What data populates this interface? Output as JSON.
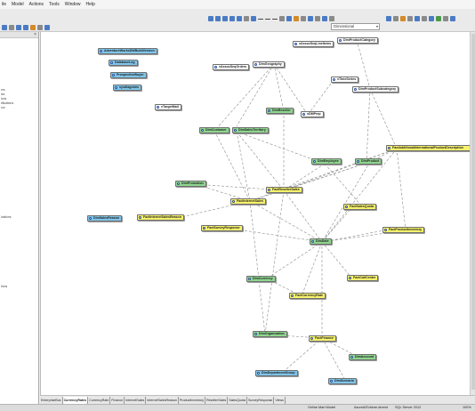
{
  "menubar": {
    "items": [
      "ile",
      "Model",
      "Actions",
      "Tools",
      "Window",
      "Help"
    ]
  },
  "toolbar": {
    "dimension_select": "Dimensional"
  },
  "left_panel": {
    "items": [
      "ers",
      "ies",
      "ions",
      "tifications",
      "rce",
      "ications",
      "tions"
    ]
  },
  "tables": [
    {
      "label": "AdventureWorksDWBuildVersion",
      "color": "blue"
    },
    {
      "label": "DatabaseLog",
      "color": "blue"
    },
    {
      "label": "ProspectiveBuyer",
      "color": "blue"
    },
    {
      "label": "sysdiagrams",
      "color": "blue"
    },
    {
      "label": "vAssocSeqLineItems",
      "color": "white"
    },
    {
      "label": "DimGeography",
      "color": "white"
    },
    {
      "label": "vAssocSeqOrders",
      "color": "white"
    },
    {
      "label": "DimProductCategory",
      "color": "white"
    },
    {
      "label": "vTimeSeries",
      "color": "white"
    },
    {
      "label": "DimProductSubcategory",
      "color": "white"
    },
    {
      "label": "vTargetMail",
      "color": "white"
    },
    {
      "label": "DimReseller",
      "color": "green"
    },
    {
      "label": "vDMPrep",
      "color": "white"
    },
    {
      "label": "DimCustomer",
      "color": "green"
    },
    {
      "label": "DimSalesTerritory",
      "color": "green"
    },
    {
      "label": "FactAdditionalInternationalProductDescription",
      "color": "yellow"
    },
    {
      "label": "DimEmployee",
      "color": "green"
    },
    {
      "label": "DimProduct",
      "color": "green"
    },
    {
      "label": "DimPromotion",
      "color": "green"
    },
    {
      "label": "FactResellerSales",
      "color": "yellow"
    },
    {
      "label": "FactInternetSales",
      "color": "yellow"
    },
    {
      "label": "FactSalesQuota",
      "color": "yellow"
    },
    {
      "label": "DimSalesReason",
      "color": "blue"
    },
    {
      "label": "FactInternetSalesReason",
      "color": "yellow"
    },
    {
      "label": "FactSurveyResponse",
      "color": "yellow"
    },
    {
      "label": "DimDate",
      "color": "green"
    },
    {
      "label": "FactProductInventory",
      "color": "yellow"
    },
    {
      "label": "DimCurrency",
      "color": "green"
    },
    {
      "label": "FactCallCenter",
      "color": "yellow"
    },
    {
      "label": "FactCurrencyRate",
      "color": "yellow"
    },
    {
      "label": "DimOrganization",
      "color": "green"
    },
    {
      "label": "FactFinance",
      "color": "yellow"
    },
    {
      "label": "DimAccount",
      "color": "green"
    },
    {
      "label": "DimDepartmentGroup",
      "color": "blue"
    },
    {
      "label": "DimScenario",
      "color": "blue"
    }
  ],
  "tabs": [
    "EnterpriseBus",
    "CurrencyRates",
    "CurrencyRate",
    "Finance",
    "InternetSales",
    "InternetSalesReason",
    "ProductInventory",
    "ResellerSales",
    "SalesQuota",
    "SurveyResponse",
    "Views"
  ],
  "active_tab_index": 1,
  "statusbar": {
    "mode": "Online Mart Model",
    "file": "AzureADVstore.dmmd",
    "db": "SQL Server 2012",
    "zoom": "100%"
  }
}
